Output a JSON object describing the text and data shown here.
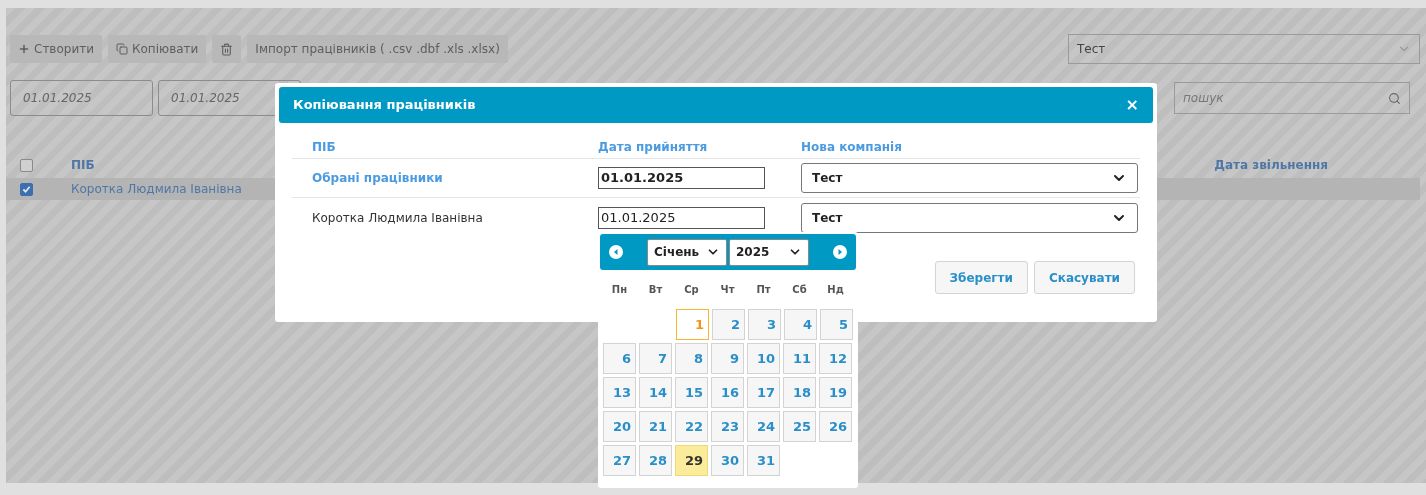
{
  "toolbar": {
    "buttons": [
      {
        "kind": "create",
        "label": "Створити"
      },
      {
        "kind": "copy",
        "label": "Копіювати"
      },
      {
        "kind": "delete"
      },
      {
        "kind": "import",
        "label": "Імпорт працівників ( .csv .dbf .xls .xlsx)"
      }
    ]
  },
  "company_select": {
    "value": "Тест"
  },
  "filters": {
    "date_from": "01.01.2025",
    "date_to": "01.01.2025"
  },
  "search": {
    "placeholder": "пошук"
  },
  "table": {
    "header_checked": false,
    "columns": [
      "ПІБ",
      "Дата звільнення"
    ],
    "rows": [
      {
        "name": "Коротка Людмила Іванівна",
        "checked": true
      }
    ]
  },
  "dialog": {
    "title": "Копіювання працівників",
    "close": "×",
    "columns": [
      "ПІБ",
      "Дата прийняття",
      "Нова компанія"
    ],
    "rows": [
      {
        "kind": "group",
        "label": "Обрані працівники",
        "date": "01.01.2025",
        "company": "Тест"
      },
      {
        "kind": "employee",
        "label": "Коротка Людмила Іванівна",
        "date": "01.01.2025",
        "company": "Тест"
      }
    ],
    "buttons": [
      "Зберегти",
      "Скасувати"
    ]
  },
  "datepicker": {
    "month": "Січень",
    "year": "2025",
    "weekdays": [
      "Пн",
      "Вт",
      "Ср",
      "Чт",
      "Пт",
      "Сб",
      "Нд"
    ],
    "weeks": [
      [
        {
          "day": "1",
          "selected": true,
          "today": false
        },
        {
          "day": "2",
          "selected": false,
          "today": false
        },
        {
          "day": "3",
          "selected": false,
          "today": false
        },
        {
          "day": "4",
          "selected": false,
          "today": false
        },
        {
          "day": "5",
          "selected": false,
          "today": false
        }
      ],
      [
        {
          "day": "6",
          "selected": false,
          "today": false
        },
        {
          "day": "7",
          "selected": false,
          "today": false
        },
        {
          "day": "8",
          "selected": false,
          "today": false
        },
        {
          "day": "9",
          "selected": false,
          "today": false
        },
        {
          "day": "10",
          "selected": false,
          "today": false
        },
        {
          "day": "11",
          "selected": false,
          "today": false
        },
        {
          "day": "12",
          "selected": false,
          "today": false
        }
      ],
      [
        {
          "day": "13",
          "selected": false,
          "today": false
        },
        {
          "day": "14",
          "selected": false,
          "today": false
        },
        {
          "day": "15",
          "selected": false,
          "today": false
        },
        {
          "day": "16",
          "selected": false,
          "today": false
        },
        {
          "day": "17",
          "selected": false,
          "today": false
        },
        {
          "day": "18",
          "selected": false,
          "today": false
        },
        {
          "day": "19",
          "selected": false,
          "today": false
        }
      ],
      [
        {
          "day": "20",
          "selected": false,
          "today": false
        },
        {
          "day": "21",
          "selected": false,
          "today": false
        },
        {
          "day": "22",
          "selected": false,
          "today": false
        },
        {
          "day": "23",
          "selected": false,
          "today": false
        },
        {
          "day": "24",
          "selected": false,
          "today": false
        },
        {
          "day": "25",
          "selected": false,
          "today": false
        },
        {
          "day": "26",
          "selected": false,
          "today": false
        }
      ],
      [
        {
          "day": "27",
          "selected": false,
          "today": false
        },
        {
          "day": "28",
          "selected": false,
          "today": false
        },
        {
          "day": "29",
          "selected": false,
          "today": true
        },
        {
          "day": "30",
          "selected": false,
          "today": false
        },
        {
          "day": "31",
          "selected": false,
          "today": false
        }
      ]
    ]
  }
}
